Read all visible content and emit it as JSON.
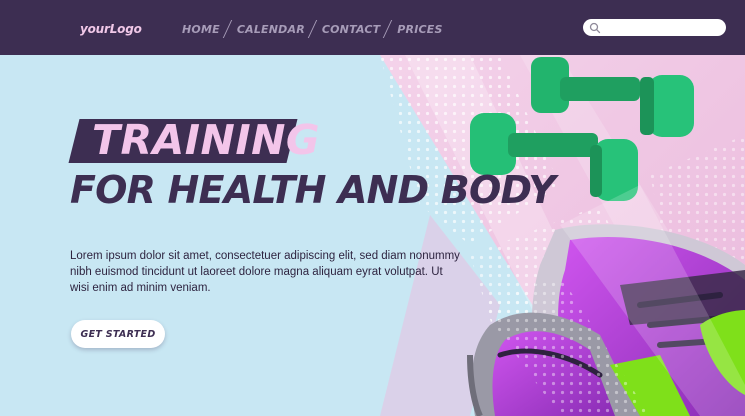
{
  "header": {
    "logo": "yourLogo",
    "nav": [
      "HOME",
      "CALENDAR",
      "CONTACT",
      "PRICES"
    ],
    "search": {
      "value": "",
      "placeholder": ""
    }
  },
  "hero": {
    "title_line1": "TRAINING",
    "title_line2": "FOR HEALTH AND BODY",
    "body": "Lorem ipsum dolor sit amet, consectetuer adipiscing elit, sed diam nonummy nibh euismod tincidunt ut laoreet dolore magna aliquam eyrat volutpat. Ut wisi enim ad minim veniam.",
    "cta_label": "GET STARTED"
  },
  "colors": {
    "header_bg": "#3d2e52",
    "hero_bg": "#c6e6f2",
    "accent_pink": "#f3c5ea",
    "dumbbell_green": "#23b56f",
    "shoe_purple": "#b23fd6",
    "shoe_lime": "#7fe01a"
  },
  "icons": {
    "search": "search-icon",
    "dumbbell": "dumbbell-icon",
    "shoe": "sneaker-image"
  }
}
